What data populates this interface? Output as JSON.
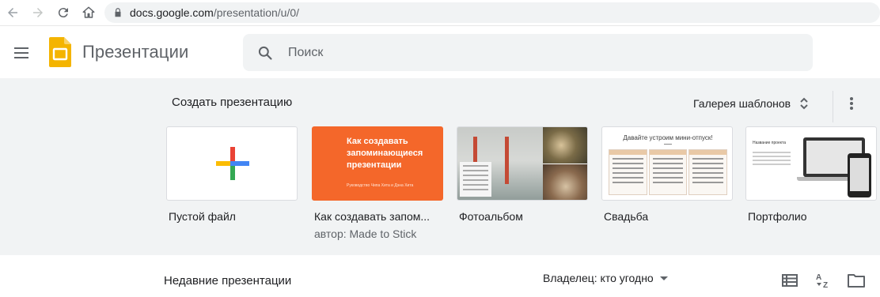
{
  "browser": {
    "url_host": "docs.google.com",
    "url_path": "/presentation/u/0/"
  },
  "header": {
    "app_title": "Презентации",
    "search_placeholder": "Поиск"
  },
  "templates": {
    "section_title": "Создать презентацию",
    "gallery_label": "Галерея шаблонов",
    "cards": [
      {
        "label": "Пустой файл"
      },
      {
        "label": "Как создавать запом...",
        "sub": "автор: Made to Stick",
        "thumb_title": "Как создавать запоминающиеся презентации",
        "thumb_subtitle": "Руководство Чипа Хита и Дэна Хита"
      },
      {
        "label": "Фотоальбом"
      },
      {
        "label": "Свадьба",
        "thumb_title": "Давайте устроим мини-отпуск!"
      },
      {
        "label": "Портфолио",
        "thumb_title": "Название проекта"
      }
    ]
  },
  "recent": {
    "title": "Недавние презентации",
    "owner_filter": "Владелец: кто угодно"
  },
  "colors": {
    "accent_orange": "#f4672a",
    "logo_yellow": "#f4b400",
    "plus_blue": "#4285f4",
    "plus_red": "#ea4335",
    "plus_yellow": "#fbbc04",
    "plus_green": "#34a853"
  }
}
